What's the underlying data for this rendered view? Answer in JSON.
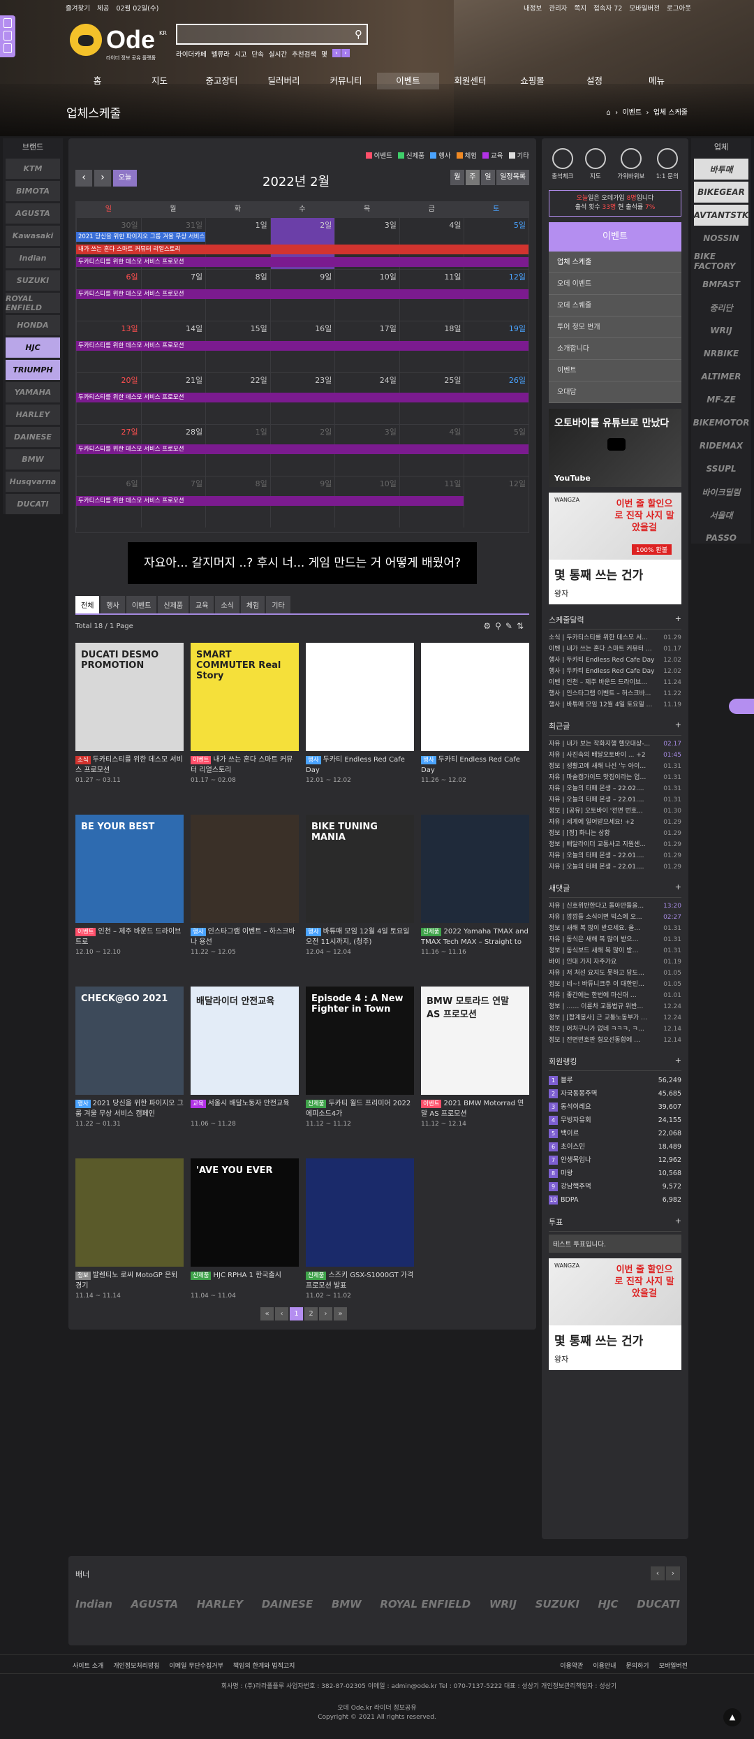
{
  "topbar": {
    "left": [
      "즐겨찾기",
      "체공",
      "02월 02일(수)"
    ],
    "right": [
      "내정보",
      "관리자",
      "쪽지",
      "접속자 72",
      "모바일버전",
      "로그아웃"
    ]
  },
  "logo": {
    "name": "Ode",
    "sup": "KR",
    "sub": "라이더 정보 공유 플랫폼"
  },
  "search": {
    "placeholder": ""
  },
  "tags": [
    "라이더카페",
    "벨류라",
    "시고",
    "단속",
    "실시간",
    "추천검색",
    "몇"
  ],
  "nav": [
    "홈",
    "지도",
    "중고장터",
    "딜러버리",
    "커뮤니티",
    "이벤트",
    "회원센터",
    "쇼핑몰",
    "설정",
    "메뉴"
  ],
  "page_title": "업체스케줄",
  "breadcrumb": [
    "이벤트",
    "업체 스케줄"
  ],
  "left_brands": {
    "title": "브랜드",
    "items": [
      "KTM",
      "BIMOTA",
      "AGUSTA",
      "Kawasaki",
      "Indian",
      "SUZUKI",
      "ROYAL ENFIELD",
      "HONDA",
      "HJC",
      "TRIUMPH",
      "YAMAHA",
      "HARLEY",
      "DAINESE",
      "BMW",
      "Husqvarna",
      "DUCATI"
    ]
  },
  "right_brands": {
    "title": "업체",
    "items": [
      "바투매",
      "BIKEGEAR",
      "AVTANTSTK",
      "NOSSIN",
      "BIKE FACTORY",
      "BMFAST",
      "중리단",
      "WRIJ",
      "NRBIKE",
      "ALTIMER",
      "MF-ZE",
      "BIKEMOTOR",
      "RIDEMAX",
      "SSUPL",
      "바이크딜림",
      "서울대",
      "PASSO"
    ]
  },
  "legend": [
    {
      "label": "이벤트",
      "color": "#ff4f6a"
    },
    {
      "label": "신제품",
      "color": "#3fcf6a"
    },
    {
      "label": "행사",
      "color": "#4aa3ff"
    },
    {
      "label": "체험",
      "color": "#f08a24"
    },
    {
      "label": "교육",
      "color": "#b232e6"
    },
    {
      "label": "기타",
      "color": "#dddddd"
    }
  ],
  "calendar": {
    "title": "2022년 2월",
    "today": "오늘",
    "views": [
      "월",
      "주",
      "일",
      "일정목록"
    ],
    "days": [
      "일",
      "월",
      "화",
      "수",
      "목",
      "금",
      "토"
    ],
    "weeks": [
      {
        "dates": [
          "30일",
          "31일",
          "1일",
          "2일",
          "3일",
          "4일",
          "5일"
        ],
        "dim": [
          0,
          1
        ]
      },
      {
        "dates": [
          "6일",
          "7일",
          "8일",
          "9일",
          "10일",
          "11일",
          "12일"
        ],
        "dim": []
      },
      {
        "dates": [
          "13일",
          "14일",
          "15일",
          "16일",
          "17일",
          "18일",
          "19일"
        ],
        "dim": []
      },
      {
        "dates": [
          "20일",
          "21일",
          "22일",
          "23일",
          "24일",
          "25일",
          "26일"
        ],
        "dim": []
      },
      {
        "dates": [
          "27일",
          "28일",
          "1일",
          "2일",
          "3일",
          "4일",
          "5일"
        ],
        "dim": [
          2,
          3,
          4,
          5,
          6
        ]
      },
      {
        "dates": [
          "6일",
          "7일",
          "8일",
          "9일",
          "10일",
          "11일",
          "12일"
        ],
        "dim": [
          0,
          1,
          2,
          3,
          4,
          5,
          6
        ]
      }
    ],
    "events": {
      "e1": "2021 당신을 위한 파이지오 그룹 겨울 무상 서비스",
      "e2": "내가 쓰는 혼다 스마트 커뮤터 리얼스토리",
      "e3": "두카티스티를 위한 데스모 서비스 프로모션"
    }
  },
  "ad_banner": "자요아... 갈지머지 ..? 후시 너... 게임 만드는 거 어떻게 배웠어?",
  "tabs": [
    "전체",
    "행사",
    "이벤트",
    "신제품",
    "교육",
    "소식",
    "체험",
    "기타"
  ],
  "total": "Total 18 / 1 Page",
  "cards": [
    {
      "tag": "소식",
      "tagc": "#d2342f",
      "title": "두카티스티를 위한 데스모 서비스 프로모션",
      "date": "01.27 ~ 03.11",
      "imgt": "DUCATI DESMO PROMOTION",
      "bg": "#d8d8d8"
    },
    {
      "tag": "이벤트",
      "tagc": "#ff4f6a",
      "title": "내가 쓰는 혼다 스마트 커뮤터 리얼스토리",
      "date": "01.17 ~ 02.08",
      "imgt": "SMART COMMUTER Real Story",
      "bg": "#f5e03a"
    },
    {
      "tag": "행사",
      "tagc": "#4aa3ff",
      "title": "두카티 Endless Red Cafe Day",
      "date": "12.01 ~ 12.02",
      "imgt": "",
      "bg": "#ffffff"
    },
    {
      "tag": "행사",
      "tagc": "#4aa3ff",
      "title": "두카티 Endless Red Cafe Day",
      "date": "11.26 ~ 12.02",
      "imgt": "",
      "bg": "#ffffff"
    },
    {
      "tag": "이벤트",
      "tagc": "#ff4f6a",
      "title": "인천 – 제주 바운드 드라이브 트로",
      "date": "12.10 ~ 12.10",
      "imgt": "BE YOUR BEST",
      "bg": "#2e6bb0"
    },
    {
      "tag": "행사",
      "tagc": "#4aa3ff",
      "title": "인스타그램 이벤트 – 하스크바나 용선",
      "date": "11.22 ~ 12.05",
      "imgt": "",
      "bg": "#3a3028"
    },
    {
      "tag": "행사",
      "tagc": "#4aa3ff",
      "title": "바튜매 모임 12월 4일 토요일 오전 11시까지, (청주)",
      "date": "12.04 ~ 12.04",
      "imgt": "BIKE TUNING MANIA",
      "bg": "#2a2a2a"
    },
    {
      "tag": "신제품",
      "tagc": "#3fa34a",
      "title": "2022 Yamaha TMAX and TMAX Tech MAX – Straight to the MAX",
      "date": "11.16 ~ 11.16",
      "imgt": "",
      "bg": "#1f2a3a"
    },
    {
      "tag": "행사",
      "tagc": "#4aa3ff",
      "title": "2021 당신을 위한 파이지오 그룹 겨울 무상 서비스 캠페인",
      "date": "11.22 ~ 01.31",
      "imgt": "CHECK@GO 2021",
      "bg": "#3d4a5a"
    },
    {
      "tag": "교육",
      "tagc": "#b232e6",
      "title": "서울시 배달노동자 안전교육",
      "date": "11.06 ~ 11.28",
      "imgt": "배달라이더 안전교육",
      "bg": "#e3ecf7"
    },
    {
      "tag": "신제품",
      "tagc": "#3fa34a",
      "title": "두카티 월드 프리미어 2022 에피소드4가",
      "date": "11.12 ~ 11.12",
      "imgt": "Episode 4 : A New Fighter in Town",
      "bg": "#111111"
    },
    {
      "tag": "이벤트",
      "tagc": "#ff4f6a",
      "title": "2021 BMW Motorrad 연말 AS 프로모션",
      "date": "11.12 ~ 12.14",
      "imgt": "BMW 모토라드 연말 AS 프로모션",
      "bg": "#f4f4f4"
    },
    {
      "tag": "정보",
      "tagc": "#888888",
      "title": "발렌티노 로씨 MotoGP 은퇴경기",
      "date": "11.14 ~ 11.14",
      "imgt": "",
      "bg": "#5a5a2a"
    },
    {
      "tag": "신제품",
      "tagc": "#3fa34a",
      "title": "HJC RPHA 1 한국출시",
      "date": "11.04 ~ 11.04",
      "imgt": "'AVE YOU EVER",
      "bg": "#0a0a0a"
    },
    {
      "tag": "신제품",
      "tagc": "#3fa34a",
      "title": "스즈키 GSX-S1000GT 가격프로모션 발표",
      "date": "11.02 ~ 11.02",
      "imgt": "",
      "bg": "#1a2a6a"
    }
  ],
  "pager": [
    "«",
    "‹",
    "1",
    "2",
    "›",
    "»"
  ],
  "quick": [
    "출석체크",
    "지도",
    "가위바위보",
    "1:1 문의"
  ],
  "notice": {
    "line1a": "오늘",
    "line1b": "일은 오데가입",
    "line1c": "8명",
    "line1d": "입니다",
    "line2a": "출석 횟수",
    "line2b": "33명",
    "line2c": "현 출석률",
    "line2d": "7%"
  },
  "sidemenu": {
    "head": "이벤트",
    "items": [
      "업체 스케줄",
      "오데 이벤트",
      "오데 스퀘줄",
      "투어 정모 번개",
      "소개합니다",
      "이벤트",
      "오대담"
    ]
  },
  "yt": {
    "text": "오토바이를 유튜브로 만났다",
    "brand": "YouTube"
  },
  "ad": {
    "brand": "WANGZA",
    "red": "이번 줄 할인으로 진작 사지 말았을걸",
    "badge": "100% 환불",
    "big": "몇 통째 쓰는 건가",
    "sm": "왕자"
  },
  "schedule": {
    "title": "스케줄달력",
    "items": [
      [
        "소식 | 두카티스티를 위한 데스모 서...",
        "01.29"
      ],
      [
        "이벤 | 내가 쓰는 혼다 스마트 커뮤터 ...",
        "01.17"
      ],
      [
        "행사 | 두카티 Endless Red Cafe Day",
        "12.02"
      ],
      [
        "행사 | 두카티 Endless Red Cafe Day",
        "12.02"
      ],
      [
        "이벤 | 인천 – 제주 바운드 드라이브...",
        "11.24"
      ],
      [
        "행사 | 인스타그램 이벤트 – 허스크바...",
        "11.22"
      ],
      [
        "행사 | 바튜매 모임 12월 4일 토요일 ...",
        "11.19"
      ]
    ]
  },
  "recent": {
    "title": "최근글",
    "items": [
      [
        "자유 | 내가 보는 작화지행 헬모대상-...",
        "02.17",
        true
      ],
      [
        "자유 | 사진속의 배달오토바이 ... +2",
        "01:45",
        true
      ],
      [
        "정보 | 생활고에 새해 나선 '누 아이…",
        "01.31",
        false
      ],
      [
        "자유 | 마술캠가이드 맛집이라는 업…",
        "01.31",
        false
      ],
      [
        "자유 | 오늘의 타페 몬생 – 22.02....",
        "01.31",
        false
      ],
      [
        "자유 | 오늘의 타페 몬생 – 22.01....",
        "01.31",
        false
      ],
      [
        "정보 | [공유] 오토바이 '전면 번호...",
        "01.30",
        false
      ],
      [
        "자유 | 세계에 일어받으세요! +2",
        "01.29",
        false
      ],
      [
        "정보 | [정] 화니는 상황",
        "01.29",
        false
      ],
      [
        "정보 | 배달라이더 교통사고 지원센...",
        "01.29",
        false
      ],
      [
        "자유 | 오늘의 타페 몬생 – 22.01....",
        "01.29",
        false
      ],
      [
        "자유 | 오늘의 타페 몬생 – 22.01....",
        "01.29",
        false
      ]
    ]
  },
  "comments": {
    "title": "새댓글",
    "items": [
      [
        "자유 | 신호위반한다고 돌아만들을...",
        "13:20",
        true
      ],
      [
        "자유 | 깜깜들 소식이면 빅스에 오...",
        "02:27",
        true
      ],
      [
        "정보 | 새해 복 많이 받으세요. 올...",
        "01.31",
        false
      ],
      [
        "자유 | 동식은 새해 복 많이 받으…",
        "01.31",
        false
      ],
      [
        "정보 | 동식보드 새해 복 많이 받…",
        "01.31",
        false
      ],
      [
        "바이 | 인대 가지 자주가요",
        "01.19",
        false
      ],
      [
        "자유 | 저 처선 요지도 못하고 당도…",
        "01.05",
        false
      ],
      [
        "정보 | 네~! 바튜니크주 이 대한민…",
        "01.05",
        false
      ],
      [
        "자유 | 좋간에는 한번에 마신대 …",
        "01.01",
        false
      ],
      [
        "정보 | …… 이륜차 교통법규 위반…",
        "12.24",
        false
      ],
      [
        "정보 | [합계봉사] 근 교통노동부가 …",
        "12.24",
        false
      ],
      [
        "정보 | 어처구니가 없네 ㅋㅋㅋ, ㅋ…",
        "12.14",
        false
      ],
      [
        "정보 | 전면번호판 형오선동함에 …",
        "12.14",
        false
      ]
    ]
  },
  "ranking": {
    "title": "회원랭킹",
    "items": [
      [
        "1",
        "블루",
        "56,249"
      ],
      [
        "2",
        "자국동몽주멱",
        "45,685"
      ],
      [
        "3",
        "동석이레요",
        "39,607"
      ],
      [
        "4",
        "무빙자유회",
        "24,155"
      ],
      [
        "5",
        "백이르",
        "22,068"
      ],
      [
        "6",
        "초이스민",
        "18,489"
      ],
      [
        "7",
        "안생목임나",
        "12,962"
      ],
      [
        "8",
        "마왕",
        "10,568"
      ],
      [
        "9",
        "강남핵주먹",
        "9,572"
      ],
      [
        "10",
        "BDPA",
        "6,982"
      ]
    ]
  },
  "poll": {
    "title": "투표",
    "text": "테스트 투표입니다."
  },
  "banners": {
    "title": "배너",
    "items": [
      "Indian",
      "AGUSTA",
      "HARLEY",
      "DAINESE",
      "BMW",
      "ROYAL ENFIELD",
      "WRIJ",
      "SUZUKI",
      "HJC",
      "DUCATI"
    ]
  },
  "footer": {
    "links_left": [
      "사이트 소개",
      "개인정보처리방침",
      "이메일 무단수집거부",
      "책임의 한계와 법적고지"
    ],
    "links_right": [
      "이용약관",
      "이용안내",
      "문의하기",
      "모바일버전"
    ],
    "info": "회사명 : (주)라라폴플루       사업자번호 : 382-87-02305       이메일 : admin@ode.kr       Tel : 070-7137-5222       대표 : 성상기       개인정보관리책임자 : 성상기",
    "name": "오데 Ode.kr 라이더 정보공유",
    "copy": "Copyright © 2021 All rights reserved."
  }
}
